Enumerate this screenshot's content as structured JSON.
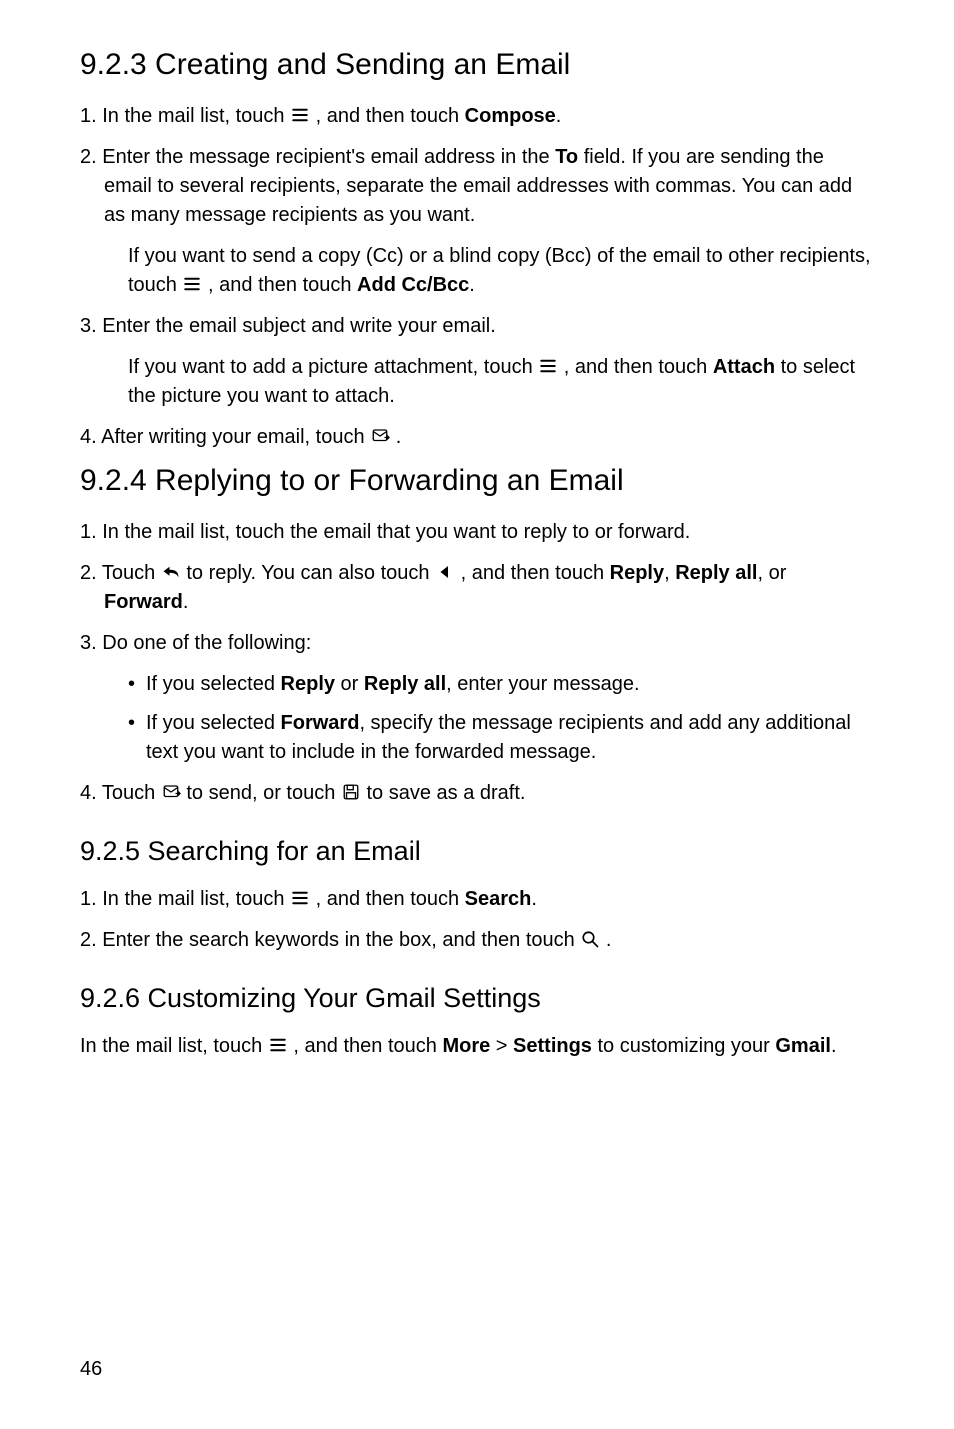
{
  "page_number": "46",
  "sections": [
    {
      "heading": "9.2.3  Creating and Sending an Email",
      "level": "h2",
      "items": [
        {
          "type": "ol",
          "prefix": "1.",
          "runs": [
            {
              "t": " In the mail list, touch "
            },
            {
              "icon": "menu"
            },
            {
              "t": " , and then touch "
            },
            {
              "t": "Compose",
              "b": true
            },
            {
              "t": "."
            }
          ]
        },
        {
          "type": "ol",
          "prefix": "2.",
          "runs": [
            {
              "t": " Enter the message recipient's email address in the "
            },
            {
              "t": "To",
              "b": true
            },
            {
              "t": " field. If you are sending the email to several recipients, separate the email addresses with commas. You can add as many message recipients as you want."
            }
          ]
        },
        {
          "type": "note",
          "runs": [
            {
              "t": "If you want to send a copy (Cc) or a blind copy (Bcc) of the email to other recipients, touch "
            },
            {
              "icon": "menu"
            },
            {
              "t": " , and then touch "
            },
            {
              "t": "Add Cc/Bcc",
              "b": true
            },
            {
              "t": "."
            }
          ]
        },
        {
          "type": "ol",
          "prefix": "3.",
          "runs": [
            {
              "t": " Enter the email subject and write your email."
            }
          ]
        },
        {
          "type": "note",
          "runs": [
            {
              "t": "If you want to add a picture attachment, touch "
            },
            {
              "icon": "menu"
            },
            {
              "t": " , and then touch "
            },
            {
              "t": "Attach",
              "b": true
            },
            {
              "t": " to select the picture you want to attach."
            }
          ]
        },
        {
          "type": "ol",
          "prefix": "4.",
          "runs": [
            {
              "t": " After writing your email, touch "
            },
            {
              "icon": "send"
            },
            {
              "t": " ."
            }
          ]
        }
      ]
    },
    {
      "heading": "9.2.4  Replying to or Forwarding an Email",
      "level": "h2",
      "items": [
        {
          "type": "ol",
          "prefix": "1.",
          "runs": [
            {
              "t": " In the mail list, touch the email that you want to reply to or forward."
            }
          ]
        },
        {
          "type": "ol",
          "prefix": "2.",
          "runs": [
            {
              "t": " Touch "
            },
            {
              "icon": "reply"
            },
            {
              "t": " to reply. You can also touch "
            },
            {
              "icon": "leftarrow"
            },
            {
              "t": " , and then touch "
            },
            {
              "t": "Reply",
              "b": true
            },
            {
              "t": ", "
            },
            {
              "t": "Reply all",
              "b": true
            },
            {
              "t": ", or "
            },
            {
              "t": "Forward",
              "b": true
            },
            {
              "t": "."
            }
          ]
        },
        {
          "type": "ol",
          "prefix": "3.",
          "runs": [
            {
              "t": " Do one of the following:"
            }
          ]
        },
        {
          "type": "bullets",
          "bullets": [
            [
              {
                "t": "If you selected "
              },
              {
                "t": "Reply",
                "b": true
              },
              {
                "t": " or "
              },
              {
                "t": "Reply all",
                "b": true
              },
              {
                "t": ", enter your message."
              }
            ],
            [
              {
                "t": "If you selected "
              },
              {
                "t": "Forward",
                "b": true
              },
              {
                "t": ", specify the message recipients and add any additional text you want to include in the forwarded message."
              }
            ]
          ]
        },
        {
          "type": "ol",
          "prefix": "4.",
          "runs": [
            {
              "t": " Touch "
            },
            {
              "icon": "send"
            },
            {
              "t": " to send, or touch "
            },
            {
              "icon": "save"
            },
            {
              "t": " to save as a draft."
            }
          ]
        }
      ]
    },
    {
      "heading": "9.2.5  Searching for an Email",
      "level": "h3",
      "items": [
        {
          "type": "ol",
          "prefix": "1.",
          "runs": [
            {
              "t": " In the mail list, touch "
            },
            {
              "icon": "menu"
            },
            {
              "t": " , and then touch "
            },
            {
              "t": "Search",
              "b": true
            },
            {
              "t": "."
            }
          ]
        },
        {
          "type": "ol",
          "prefix": "2.",
          "runs": [
            {
              "t": " Enter the search keywords in the box, and then touch "
            },
            {
              "icon": "search"
            },
            {
              "t": " ."
            }
          ]
        }
      ]
    },
    {
      "heading": "9.2.6  Customizing Your Gmail Settings",
      "level": "h3",
      "items": [
        {
          "type": "para",
          "runs": [
            {
              "t": "In the mail list, touch "
            },
            {
              "icon": "menu"
            },
            {
              "t": " , and then touch "
            },
            {
              "t": "More",
              "b": true
            },
            {
              "t": " > "
            },
            {
              "t": "Settings",
              "b": true
            },
            {
              "t": " to customizing your "
            },
            {
              "t": "Gmail",
              "b": true
            },
            {
              "t": "."
            }
          ]
        }
      ]
    }
  ]
}
